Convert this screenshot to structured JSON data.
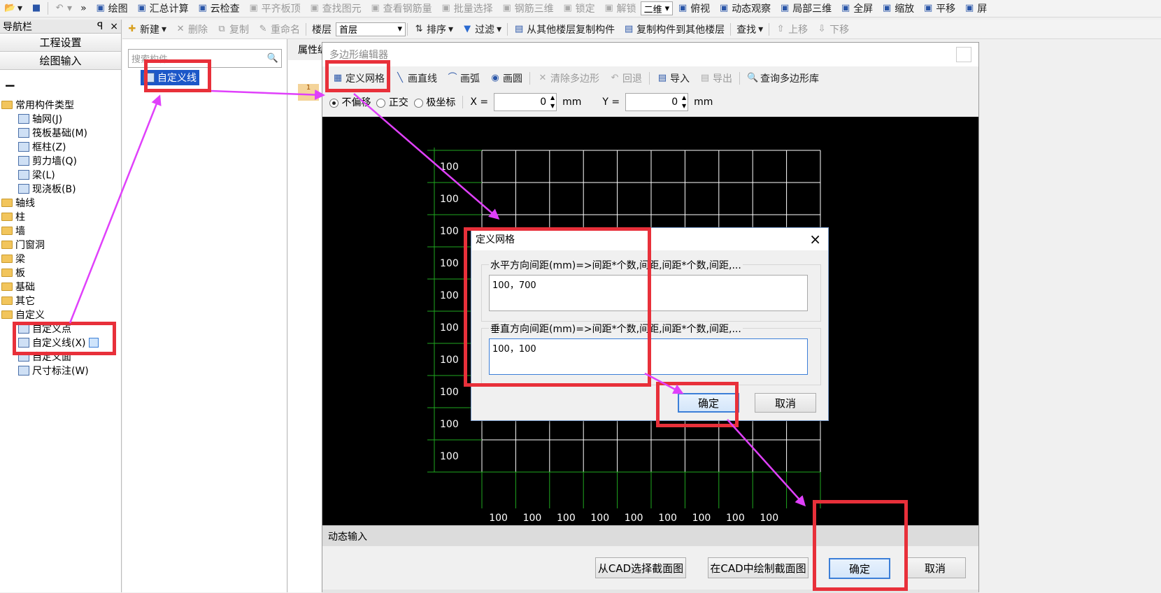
{
  "toolbar1": {
    "items": [
      {
        "label": "绘图",
        "icon": "draw-icon"
      },
      {
        "label": "汇总计算",
        "icon": "sigma-icon"
      },
      {
        "label": "云检查",
        "icon": "cloud-check-icon"
      },
      {
        "label": "平齐板顶",
        "icon": "align-top-icon",
        "disabled": true
      },
      {
        "label": "查找图元",
        "icon": "find-element-icon",
        "disabled": true
      },
      {
        "label": "查看钢筋量",
        "icon": "rebar-view-icon",
        "disabled": true
      },
      {
        "label": "批量选择",
        "icon": "batch-select-icon",
        "disabled": true
      },
      {
        "label": "钢筋三维",
        "icon": "rebar-3d-icon",
        "disabled": true
      },
      {
        "label": "锁定",
        "icon": "lock-icon",
        "disabled": true
      },
      {
        "label": "解锁",
        "icon": "unlock-icon",
        "disabled": true
      }
    ],
    "view_combo": "二维",
    "items2": [
      {
        "label": "俯视",
        "icon": "top-view-icon"
      },
      {
        "label": "动态观察",
        "icon": "orbit-icon"
      },
      {
        "label": "局部三维",
        "icon": "local-3d-icon"
      },
      {
        "label": "全屏",
        "icon": "fullscreen-icon"
      },
      {
        "label": "缩放",
        "icon": "zoom-icon"
      },
      {
        "label": "平移",
        "icon": "pan-icon"
      },
      {
        "label": "屏",
        "icon": "screen-icon"
      }
    ]
  },
  "toolbar2": {
    "new_label": "新建",
    "delete_label": "删除",
    "copy_label": "复制",
    "rename_label": "重命名",
    "floor_label": "楼层",
    "floor_value": "首层",
    "sort_label": "排序",
    "filter_label": "过滤",
    "copy_from_label": "从其他楼层复制构件",
    "copy_to_label": "复制构件到其他楼层",
    "find_label": "查找",
    "up_label": "上移",
    "down_label": "下移"
  },
  "nav": {
    "title": "导航栏",
    "pin": "ꟼ",
    "close": "×",
    "btn_settings": "工程设置",
    "btn_drawing": "绘图输入",
    "collapse": "−",
    "tree": [
      {
        "label": "常用构件类型",
        "type": "folder",
        "level": 0
      },
      {
        "label": "轴网(J)",
        "type": "leaf",
        "level": 1,
        "icon": "grid-icon"
      },
      {
        "label": "筏板基础(M)",
        "type": "leaf",
        "level": 1,
        "icon": "raft-icon"
      },
      {
        "label": "框柱(Z)",
        "type": "leaf",
        "level": 1,
        "icon": "column-icon"
      },
      {
        "label": "剪力墙(Q)",
        "type": "leaf",
        "level": 1,
        "icon": "wall-icon"
      },
      {
        "label": "梁(L)",
        "type": "leaf",
        "level": 1,
        "icon": "beam-icon"
      },
      {
        "label": "现浇板(B)",
        "type": "leaf",
        "level": 1,
        "icon": "slab-icon"
      },
      {
        "label": "轴线",
        "type": "folder",
        "level": 0
      },
      {
        "label": "柱",
        "type": "folder",
        "level": 0
      },
      {
        "label": "墙",
        "type": "folder",
        "level": 0
      },
      {
        "label": "门窗洞",
        "type": "folder",
        "level": 0
      },
      {
        "label": "梁",
        "type": "folder",
        "level": 0
      },
      {
        "label": "板",
        "type": "folder",
        "level": 0
      },
      {
        "label": "基础",
        "type": "folder",
        "level": 0
      },
      {
        "label": "其它",
        "type": "folder",
        "level": 0
      },
      {
        "label": "自定义",
        "type": "folder",
        "level": 0
      },
      {
        "label": "自定义点",
        "type": "leaf",
        "level": 1,
        "icon": "custom-point-icon"
      },
      {
        "label": "自定义线(X)",
        "type": "leaf",
        "level": 1,
        "icon": "custom-line-icon",
        "selected": true
      },
      {
        "label": "自定义面",
        "type": "leaf",
        "level": 1,
        "icon": "custom-face-icon"
      },
      {
        "label": "尺寸标注(W)",
        "type": "leaf",
        "level": 1,
        "icon": "dimension-icon"
      }
    ]
  },
  "midpanel": {
    "search_placeholder": "搜索构件...",
    "item": "自定义线"
  },
  "prop_tab": "属性编",
  "editor": {
    "title": "多边形编辑器",
    "tools": [
      {
        "label": "定义网格",
        "icon": "grid-define-icon"
      },
      {
        "label": "画直线",
        "icon": "line-icon"
      },
      {
        "label": "画弧",
        "icon": "arc-icon"
      },
      {
        "label": "画圆",
        "icon": "circle-icon"
      },
      {
        "label": "清除多边形",
        "icon": "clear-icon",
        "disabled": true
      },
      {
        "label": "回退",
        "icon": "undo-icon",
        "disabled": true
      },
      {
        "label": "导入",
        "icon": "import-icon"
      },
      {
        "label": "导出",
        "icon": "export-icon",
        "disabled": true
      },
      {
        "label": "查询多边形库",
        "icon": "query-library-icon"
      }
    ],
    "radio_no_offset": "不偏移",
    "radio_ortho": "正交",
    "radio_polar": "极坐标",
    "x_label": "X =",
    "x_value": "0",
    "y_label": "Y =",
    "y_value": "0",
    "unit": "mm",
    "row_labels": [
      "100",
      "100",
      "100",
      "100",
      "100",
      "100",
      "100",
      "100",
      "100",
      "100"
    ],
    "col_labels": [
      "100",
      "100",
      "100",
      "100",
      "100",
      "100",
      "100",
      "100",
      "100"
    ],
    "dynamic_input": "动态输入",
    "btn_cad_select": "从CAD选择截面图",
    "btn_cad_draw": "在CAD中绘制截面图",
    "btn_ok": "确定",
    "btn_cancel": "取消"
  },
  "dialog": {
    "title": "定义网格",
    "close": "×",
    "horiz_label": "水平方向间距(mm)=>间距*个数,间距,间距*个数,间距,...",
    "horiz_value": "100，700",
    "vert_label": "垂直方向间距(mm)=>间距*个数,间距,间距*个数,间距,...",
    "vert_value": "100，100",
    "btn_ok": "确定",
    "btn_cancel": "取消"
  },
  "colors": {
    "annotation_red": "#e8303a",
    "arrow_magenta": "#e040fb",
    "grid_white": "#ffffff",
    "axis_green": "#1fa81f",
    "selection_blue": "#1c57c8"
  }
}
